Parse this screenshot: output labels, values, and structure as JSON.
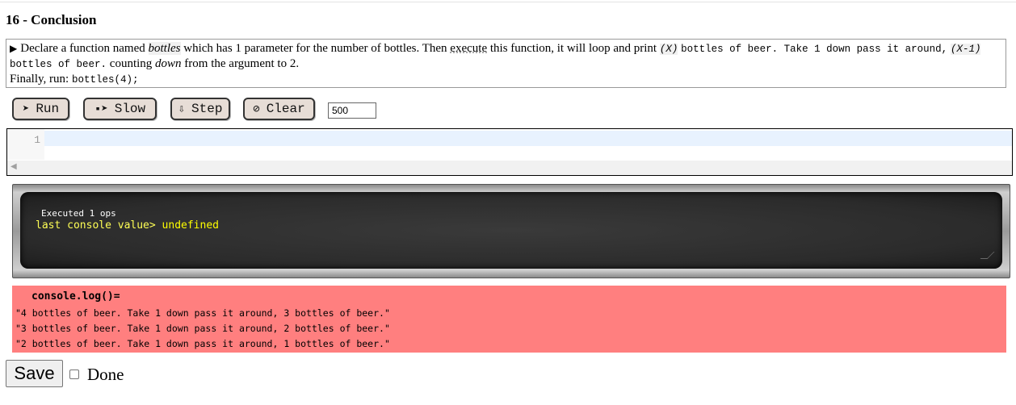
{
  "lesson": {
    "title": "16 - Conclusion",
    "description": {
      "toggle": "▶",
      "p1": "Declare a function named",
      "fname": "bottles",
      "p2": "which has 1 parameter for the number of bottles. Then",
      "p_exec": "execute",
      "p3": "this function, it will loop and print",
      "code_x": "(X)",
      "code_mid": "bottles of beer. Take 1 down pass it around,",
      "code_x1": "(X-1)",
      "code_end": "bottles of beer.",
      "p4": "counting",
      "down": "down",
      "p5": "from the argument to 2.",
      "finally": "Finally, run:",
      "run_code": "bottles(4);"
    }
  },
  "toolbar": {
    "run_icon": "➤",
    "run_label": "Run",
    "slow_icon": "▪➤",
    "slow_label": "Slow",
    "step_icon": "⇩",
    "step_label": "Step",
    "clear_icon": "⊘",
    "clear_label": "Clear",
    "speed_value": "500"
  },
  "editor": {
    "line_number": "1"
  },
  "console": {
    "executed": "Executed 1 ops",
    "last_label": "last console value>",
    "last_value": "undefined"
  },
  "output": {
    "header": "console.log()=",
    "lines": [
      "\"4 bottles of beer. Take 1 down pass it around, 3 bottles of beer.\"",
      "\"3 bottles of beer. Take 1 down pass it around, 2 bottles of beer.\"",
      "\"2 bottles of beer. Take 1 down pass it around, 1 bottles of beer.\""
    ]
  },
  "footer": {
    "save_label": "Save",
    "done_label": "Done"
  }
}
